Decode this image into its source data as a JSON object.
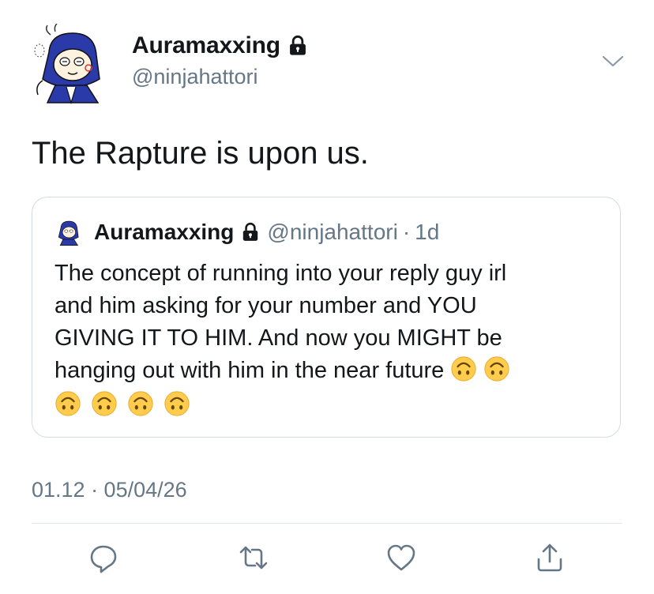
{
  "author": {
    "display_name": "Auramaxxing",
    "handle": "@ninjahattori",
    "avatar_icon": "ninja-avatar",
    "lock_icon": "lock-icon"
  },
  "tweet": {
    "text": "The Rapture is upon us.",
    "timestamp": "01.12 · 05/04/26"
  },
  "quoted_tweet": {
    "display_name": "Auramaxxing",
    "handle": "@ninjahattori",
    "separator": "·",
    "time": "1d",
    "text_lines": [
      "The concept of running into your reply guy irl",
      "and him asking for your number and YOU",
      "GIVING IT TO HIM. And now you MIGHT be",
      "hanging out with him in the near future"
    ],
    "trailing_emoji": "upside-down-face",
    "emoji_count_line4": 2,
    "emoji_count_line5": 4
  },
  "actions": [
    "reply-icon",
    "retweet-icon",
    "like-icon",
    "share-icon"
  ],
  "colors": {
    "text": "#14171a",
    "secondary": "#657786",
    "border": "#d4dbe0",
    "emoji": "#ffcc4d"
  }
}
